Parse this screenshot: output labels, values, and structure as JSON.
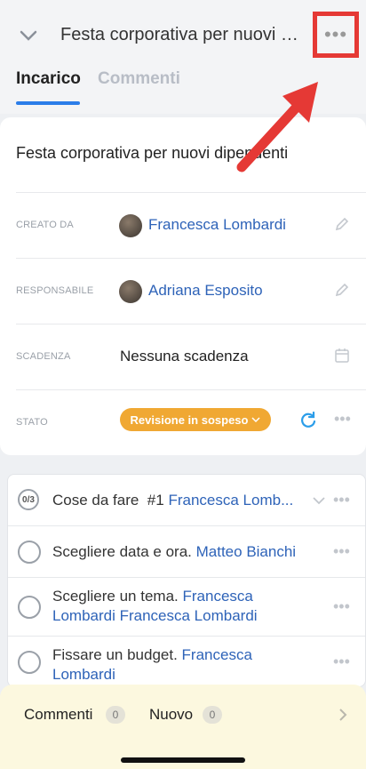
{
  "header": {
    "title": "Festa corporativa per nuovi di...",
    "more_label": "•••"
  },
  "tabs": [
    {
      "label": "Incarico",
      "active": true
    },
    {
      "label": "Commenti",
      "active": false
    }
  ],
  "task": {
    "title": "Festa corporativa per nuovi dipendenti",
    "fields": {
      "created_by": {
        "label": "CREATO DA",
        "value": "Francesca Lombardi"
      },
      "assignee": {
        "label": "RESPONSABILE",
        "value": "Adriana Esposito"
      },
      "deadline": {
        "label": "SCADENZA",
        "value": "Nessuna scadenza"
      },
      "status": {
        "label": "STATO",
        "value": "Revisione in sospeso",
        "color": "#f0a833"
      }
    }
  },
  "checklist": {
    "header": {
      "count": "0/3",
      "title": "Cose da fare",
      "ref": "#1",
      "owner": "Francesca Lomb..."
    },
    "items": [
      {
        "text": "Scegliere data e ora.",
        "mentions": "Matteo Bianchi"
      },
      {
        "text": "Scegliere un tema.",
        "mentions": "Francesca Lombardi Francesca Lombardi"
      },
      {
        "text": "Fissare un budget.",
        "mentions": "Francesca Lombardi"
      }
    ]
  },
  "bottom_bar": {
    "comments_label": "Commenti",
    "comments_count": "0",
    "new_label": "Nuovo",
    "new_count": "0"
  },
  "colors": {
    "accent": "#2b7de9",
    "link": "#2e63b8",
    "highlight": "#e53935",
    "bottom_bar": "#fcf8df"
  }
}
